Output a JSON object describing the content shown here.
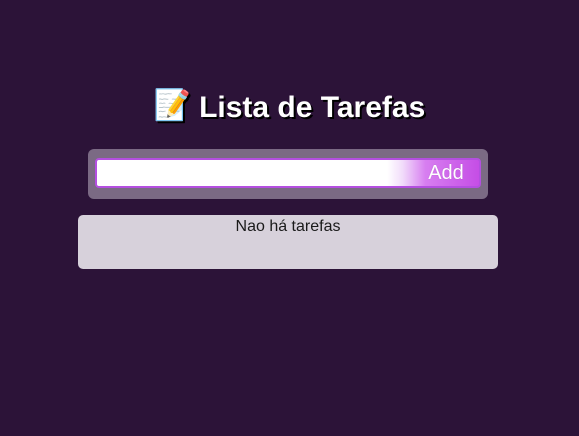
{
  "header": {
    "icon": "memo-icon",
    "emoji": "📝",
    "title": "Lista de Tarefas"
  },
  "input": {
    "value": "",
    "placeholder": ""
  },
  "add_button": {
    "label": "Add"
  },
  "task_list": {
    "empty_message": "Nao há tarefas",
    "items": []
  },
  "colors": {
    "background": "#2c1338",
    "card": "#7b6a84",
    "accent": "#c54ee6",
    "list_background": "#d7d1db"
  }
}
